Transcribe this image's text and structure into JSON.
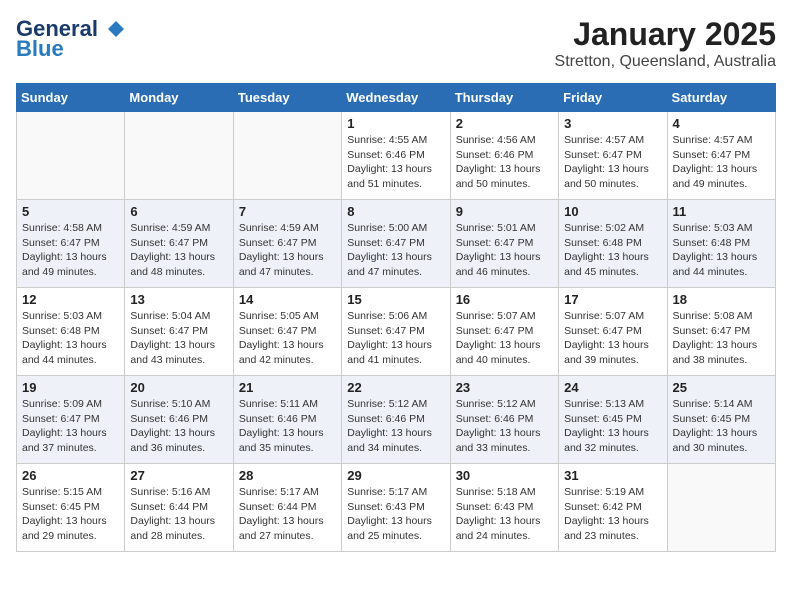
{
  "header": {
    "logo_general": "General",
    "logo_blue": "Blue",
    "month": "January 2025",
    "location": "Stretton, Queensland, Australia"
  },
  "days_of_week": [
    "Sunday",
    "Monday",
    "Tuesday",
    "Wednesday",
    "Thursday",
    "Friday",
    "Saturday"
  ],
  "weeks": [
    [
      {
        "day": "",
        "info": ""
      },
      {
        "day": "",
        "info": ""
      },
      {
        "day": "",
        "info": ""
      },
      {
        "day": "1",
        "info": "Sunrise: 4:55 AM\nSunset: 6:46 PM\nDaylight: 13 hours\nand 51 minutes."
      },
      {
        "day": "2",
        "info": "Sunrise: 4:56 AM\nSunset: 6:46 PM\nDaylight: 13 hours\nand 50 minutes."
      },
      {
        "day": "3",
        "info": "Sunrise: 4:57 AM\nSunset: 6:47 PM\nDaylight: 13 hours\nand 50 minutes."
      },
      {
        "day": "4",
        "info": "Sunrise: 4:57 AM\nSunset: 6:47 PM\nDaylight: 13 hours\nand 49 minutes."
      }
    ],
    [
      {
        "day": "5",
        "info": "Sunrise: 4:58 AM\nSunset: 6:47 PM\nDaylight: 13 hours\nand 49 minutes."
      },
      {
        "day": "6",
        "info": "Sunrise: 4:59 AM\nSunset: 6:47 PM\nDaylight: 13 hours\nand 48 minutes."
      },
      {
        "day": "7",
        "info": "Sunrise: 4:59 AM\nSunset: 6:47 PM\nDaylight: 13 hours\nand 47 minutes."
      },
      {
        "day": "8",
        "info": "Sunrise: 5:00 AM\nSunset: 6:47 PM\nDaylight: 13 hours\nand 47 minutes."
      },
      {
        "day": "9",
        "info": "Sunrise: 5:01 AM\nSunset: 6:47 PM\nDaylight: 13 hours\nand 46 minutes."
      },
      {
        "day": "10",
        "info": "Sunrise: 5:02 AM\nSunset: 6:48 PM\nDaylight: 13 hours\nand 45 minutes."
      },
      {
        "day": "11",
        "info": "Sunrise: 5:03 AM\nSunset: 6:48 PM\nDaylight: 13 hours\nand 44 minutes."
      }
    ],
    [
      {
        "day": "12",
        "info": "Sunrise: 5:03 AM\nSunset: 6:48 PM\nDaylight: 13 hours\nand 44 minutes."
      },
      {
        "day": "13",
        "info": "Sunrise: 5:04 AM\nSunset: 6:47 PM\nDaylight: 13 hours\nand 43 minutes."
      },
      {
        "day": "14",
        "info": "Sunrise: 5:05 AM\nSunset: 6:47 PM\nDaylight: 13 hours\nand 42 minutes."
      },
      {
        "day": "15",
        "info": "Sunrise: 5:06 AM\nSunset: 6:47 PM\nDaylight: 13 hours\nand 41 minutes."
      },
      {
        "day": "16",
        "info": "Sunrise: 5:07 AM\nSunset: 6:47 PM\nDaylight: 13 hours\nand 40 minutes."
      },
      {
        "day": "17",
        "info": "Sunrise: 5:07 AM\nSunset: 6:47 PM\nDaylight: 13 hours\nand 39 minutes."
      },
      {
        "day": "18",
        "info": "Sunrise: 5:08 AM\nSunset: 6:47 PM\nDaylight: 13 hours\nand 38 minutes."
      }
    ],
    [
      {
        "day": "19",
        "info": "Sunrise: 5:09 AM\nSunset: 6:47 PM\nDaylight: 13 hours\nand 37 minutes."
      },
      {
        "day": "20",
        "info": "Sunrise: 5:10 AM\nSunset: 6:46 PM\nDaylight: 13 hours\nand 36 minutes."
      },
      {
        "day": "21",
        "info": "Sunrise: 5:11 AM\nSunset: 6:46 PM\nDaylight: 13 hours\nand 35 minutes."
      },
      {
        "day": "22",
        "info": "Sunrise: 5:12 AM\nSunset: 6:46 PM\nDaylight: 13 hours\nand 34 minutes."
      },
      {
        "day": "23",
        "info": "Sunrise: 5:12 AM\nSunset: 6:46 PM\nDaylight: 13 hours\nand 33 minutes."
      },
      {
        "day": "24",
        "info": "Sunrise: 5:13 AM\nSunset: 6:45 PM\nDaylight: 13 hours\nand 32 minutes."
      },
      {
        "day": "25",
        "info": "Sunrise: 5:14 AM\nSunset: 6:45 PM\nDaylight: 13 hours\nand 30 minutes."
      }
    ],
    [
      {
        "day": "26",
        "info": "Sunrise: 5:15 AM\nSunset: 6:45 PM\nDaylight: 13 hours\nand 29 minutes."
      },
      {
        "day": "27",
        "info": "Sunrise: 5:16 AM\nSunset: 6:44 PM\nDaylight: 13 hours\nand 28 minutes."
      },
      {
        "day": "28",
        "info": "Sunrise: 5:17 AM\nSunset: 6:44 PM\nDaylight: 13 hours\nand 27 minutes."
      },
      {
        "day": "29",
        "info": "Sunrise: 5:17 AM\nSunset: 6:43 PM\nDaylight: 13 hours\nand 25 minutes."
      },
      {
        "day": "30",
        "info": "Sunrise: 5:18 AM\nSunset: 6:43 PM\nDaylight: 13 hours\nand 24 minutes."
      },
      {
        "day": "31",
        "info": "Sunrise: 5:19 AM\nSunset: 6:42 PM\nDaylight: 13 hours\nand 23 minutes."
      },
      {
        "day": "",
        "info": ""
      }
    ]
  ]
}
